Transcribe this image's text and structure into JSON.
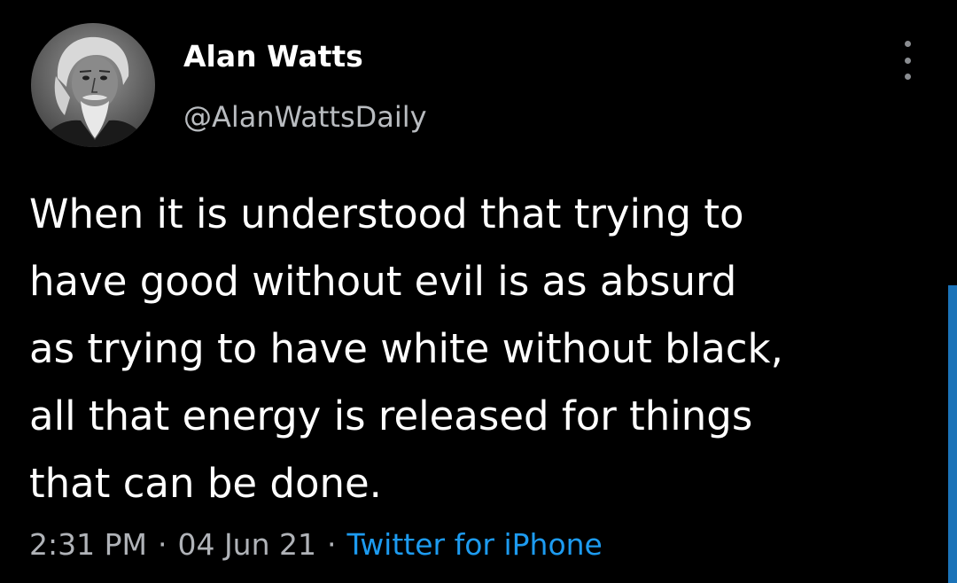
{
  "author": {
    "display_name": "Alan Watts",
    "handle": "@AlanWattsDaily",
    "avatar_icon": "portrait-avatar"
  },
  "tweet": {
    "lines": [
      "When it is understood that trying to",
      "have good without evil is as absurd",
      "as trying to have white without black,",
      "all that energy is released for things",
      "that can be done."
    ]
  },
  "meta": {
    "time": "2:31 PM",
    "separator": "·",
    "date": "04 Jun 21",
    "source": "Twitter for iPhone"
  },
  "colors": {
    "background": "#000000",
    "text": "#ffffff",
    "secondary_text": "#b0b3b8",
    "link": "#1d9bf0",
    "scroll_indicator": "#1b73b8"
  },
  "icons": {
    "more_options": "more-vertical-icon"
  }
}
